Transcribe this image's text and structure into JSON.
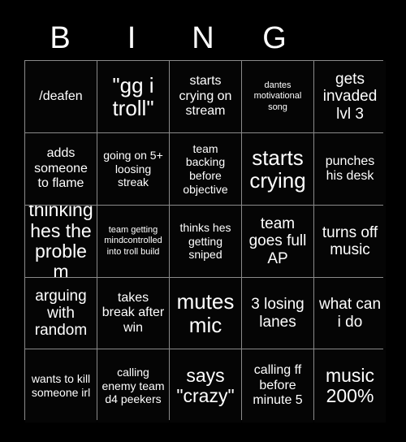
{
  "card": {
    "title_letters": [
      "B",
      "I",
      "N",
      "G"
    ],
    "background_color": "#000000",
    "cell_background_color": "#050505",
    "grid_line_color": "#8a8a8a",
    "text_color": "#ffffff",
    "columns": 5,
    "rows": 5
  },
  "cells": [
    {
      "text": "/deafen",
      "size": "md"
    },
    {
      "text": "\"gg i troll\"",
      "size": "xxl"
    },
    {
      "text": "starts crying on stream",
      "size": "md"
    },
    {
      "text": "dantes motivational song",
      "size": "xs"
    },
    {
      "text": "gets invaded lvl 3",
      "size": "lg"
    },
    {
      "text": "adds someone to flame",
      "size": "md"
    },
    {
      "text": "going on 5+ loosing streak",
      "size": "sm"
    },
    {
      "text": "team backing before objective",
      "size": "sm"
    },
    {
      "text": "starts crying",
      "size": "xxl"
    },
    {
      "text": "punches his desk",
      "size": "md"
    },
    {
      "text": "thinking hes the problem",
      "size": "xl"
    },
    {
      "text": "team getting mindcontrolled into troll build",
      "size": "xs"
    },
    {
      "text": "thinks hes getting sniped",
      "size": "sm"
    },
    {
      "text": "team goes full AP",
      "size": "lg"
    },
    {
      "text": "turns off music",
      "size": "lg"
    },
    {
      "text": "arguing with random",
      "size": "lg"
    },
    {
      "text": "takes break after win",
      "size": "md"
    },
    {
      "text": "mutes mic",
      "size": "xxl"
    },
    {
      "text": "3 losing lanes",
      "size": "lg"
    },
    {
      "text": "what can i do",
      "size": "lg"
    },
    {
      "text": "wants to kill someone irl",
      "size": "sm"
    },
    {
      "text": "calling enemy team d4 peekers",
      "size": "sm"
    },
    {
      "text": "says \"crazy\"",
      "size": "xl"
    },
    {
      "text": "calling ff before minute 5",
      "size": "md"
    },
    {
      "text": "music 200%",
      "size": "xl"
    }
  ]
}
